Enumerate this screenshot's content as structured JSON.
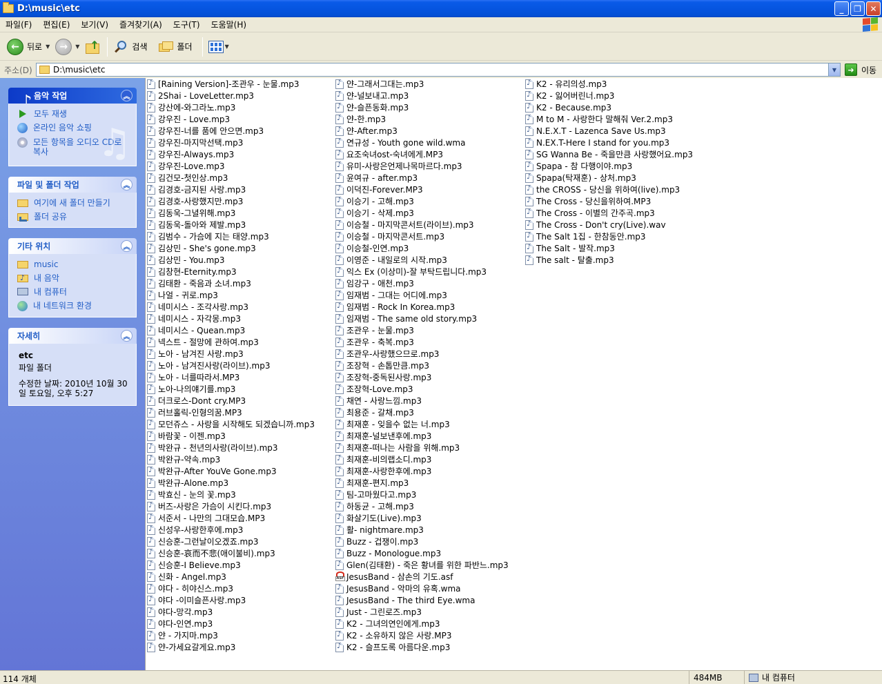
{
  "window": {
    "title": "D:\\music\\etc"
  },
  "menu": [
    "파일(F)",
    "편집(E)",
    "보기(V)",
    "즐겨찾기(A)",
    "도구(T)",
    "도움말(H)"
  ],
  "toolbar": {
    "back_label": "뒤로",
    "search_label": "검색",
    "folders_label": "폴더"
  },
  "address": {
    "label": "주소(D)",
    "value": "D:\\music\\etc",
    "go_label": "이동"
  },
  "taskpane": {
    "music_tasks": {
      "title": "음악 작업",
      "items": [
        "모두 재생",
        "온라인 음악 쇼핑",
        "모든 항목을 오디오 CD로 복사"
      ]
    },
    "file_tasks": {
      "title": "파일 및 폴더 작업",
      "items": [
        "여기에 새 폴더 만들기",
        "폴더 공유"
      ]
    },
    "other_places": {
      "title": "기타 위치",
      "items": [
        "music",
        "내 음악",
        "내 컴퓨터",
        "내 네트워크 환경"
      ]
    },
    "details": {
      "title": "자세히",
      "name": "etc",
      "type": "파일 폴더",
      "date": "수정한 날짜: 2010년 10월 30일 토요일, 오후 5:27"
    }
  },
  "files": {
    "col1": [
      "[Raining Version]-조관우 - 눈물.mp3",
      "2Shai - LoveLetter.mp3",
      "강산에-와그라노.mp3",
      "강우진 - Love.mp3",
      "강우진-너를 품에 안으면.mp3",
      "강우진-마지막선택.mp3",
      "강우진-Always.mp3",
      "강우진-Love.mp3",
      "김건모-첫인상.mp3",
      "김경호-금지된 사랑.mp3",
      "김경호-사랑했지만.mp3",
      "김동욱-그녈위해.mp3",
      "김동욱-돌아와 제발.mp3",
      "김범수 - 가슴에 지는 태양.mp3",
      "김상민 - She's gone.mp3",
      "김상민 - You.mp3",
      "김창현-Eternity.mp3",
      "김태환 - 죽음과 소녀.mp3",
      "나얼 - 귀로.mp3",
      "네미시스  - 조각사랑.mp3",
      "네미시스 - 자각몽.mp3",
      "네미시스 - Quean.mp3",
      "넥스트 - 절망에 관하여.mp3",
      "노아 - 남겨진 사랑.mp3",
      "노아 - 남겨진사랑(라이브).mp3",
      "노아 - 너를따라서.MP3",
      "노아-나의얘기를.mp3",
      "더크로스-Dont cry.MP3",
      "러브홀릭-인형의꿈.MP3",
      "모던쥬스 - 사랑을 시작해도 되겠습니까.mp3",
      "바람꽃 - 이젠.mp3",
      "박완규 - 천년의사랑(라이브).mp3",
      "박완규-약속.mp3",
      "박완규-After YouVe Gone.mp3",
      "박완규-Alone.mp3",
      "박효신 - 눈의 꽃.mp3",
      "버즈-사랑은 가슴이 시킨다.mp3",
      "서준서 - 나만의 그대모습.MP3",
      "신성우-사랑한후에.mp3",
      "신승훈-그런날이오겠죠.mp3",
      "신승훈-哀而不悲(애이불비).mp3",
      "신승훈-I Believe.mp3",
      "신화 - Angel.mp3",
      "야다 - 히야신스.mp3",
      "야다 -이미슬픈사랑.mp3",
      "야다-망각.mp3",
      "야다-인연.mp3",
      "얀 - 가지마.mp3",
      "얀-가세요갈게요.mp3"
    ],
    "col2": [
      "얀-그래서그대는.mp3",
      "얀-널보내고.mp3",
      "얀-슬픈동화.mp3",
      "얀-한.mp3",
      "얀-After.mp3",
      "연규성 - Youth gone wild.wma",
      "요조숙녀ost-숙녀에게.MP3",
      "유미-사랑은언제나목마르다.mp3",
      "윤여규 - after.mp3",
      "이덕진-Forever.MP3",
      "이승기 - 고해.mp3",
      "이승기 - 삭제.mp3",
      "이승철 - 마지막콘서트(라이브).mp3",
      "이승철 - 마지막콘서트.mp3",
      "이승철-인연.mp3",
      "이영준 - 내일로의 시작.mp3",
      "익스 Ex (이상미)-잘 부탁드립니다.mp3",
      "임강구 - 애천.mp3",
      "임재범 - 그대는 어디에.mp3",
      "임재범 - Rock In Korea.mp3",
      "임재범 - The same old story.mp3",
      "조관우 - 눈물.mp3",
      "조관우 - 축복.mp3",
      "조관우-사랑했으므로.mp3",
      "조장혁 -  손톱만큼.mp3",
      "조장혁-중독된사랑.mp3",
      "조장혁-Love.mp3",
      "채연 - 사랑느낌.mp3",
      "최용준 - 갈채.mp3",
      "최재훈 - 잊을수 없는 너.mp3",
      "최재훈-널보낸후에.mp3",
      "최재훈-떠나는 사람을 위해.mp3",
      "최재훈-비의랩소디.mp3",
      "최재훈-사랑한후에.mp3",
      "최재훈-편지.mp3",
      "팀-고마웠다고.mp3",
      "하동균 - 고해.mp3",
      "화살기도(Live).mp3",
      "활- nightmare.mp3",
      "Buzz - 겁쟁이.mp3",
      "Buzz - Monologue.mp3",
      "Glen(김태환) - 죽은 황녀를 위한 파반느.mp3",
      "JesusBand - 삼손의 기도.asf",
      "JesusBand - 악마의 유혹.wma",
      "JesusBand - The third Eye.wma",
      "Just - 그린로즈.mp3",
      "K2 - 그녀의연인에게.mp3",
      "K2 - 소유하지 않은 사랑.MP3",
      "K2 - 슬프도록 아름다운.mp3"
    ],
    "col3": [
      "K2 - 유리의성.mp3",
      "K2 - 잃어버린너.mp3",
      "K2 - Because.mp3",
      "M to M - 사랑한다 말해줘 Ver.2.mp3",
      "N.E.X.T - Lazenca Save Us.mp3",
      "N.EX.T-Here I stand for you.mp3",
      "SG Wanna Be - 죽을만큼 사랑했어요.mp3",
      "Spapa - 참 다행이야.mp3",
      "Spapa(탁재훈) - 상처.mp3",
      "the CROSS - 당신을 위하여(live).mp3",
      "The Cross - 당신을위하여.MP3",
      "The Cross - 이별의 간주곡.mp3",
      "The Cross - Don't cry(Live).wav",
      "The Salt 1집 - 한참동안.mp3",
      "The Salt - 발작.mp3",
      "The salt - 탈출.mp3"
    ]
  },
  "status": {
    "count": "114 개체",
    "size": "484MB",
    "location": "내 컴퓨터"
  }
}
